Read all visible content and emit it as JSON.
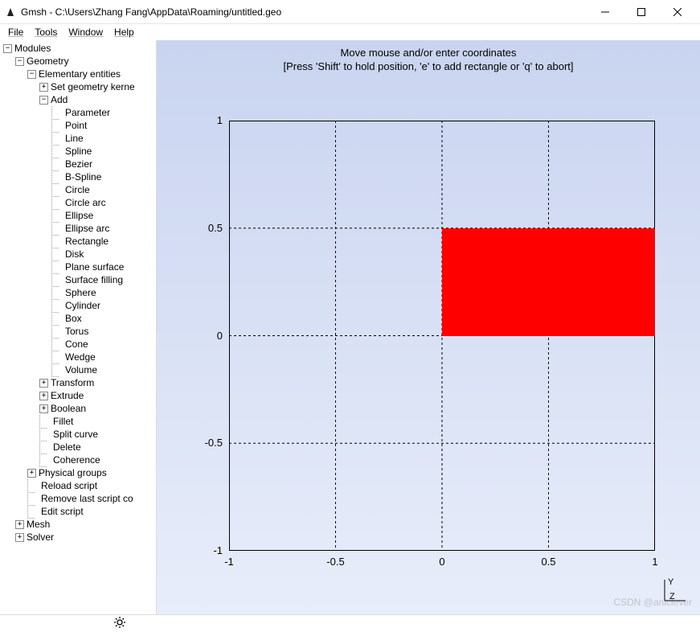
{
  "window": {
    "title": "Gmsh - C:\\Users\\Zhang Fang\\AppData\\Roaming/untitled.geo"
  },
  "menu": {
    "file": "File",
    "tools": "Tools",
    "window": "Window",
    "help": "Help"
  },
  "tree": {
    "root": "Modules",
    "geometry": "Geometry",
    "elementary": "Elementary entities",
    "set_kernel": "Set geometry kerne",
    "add": "Add",
    "add_items": [
      "Parameter",
      "Point",
      "Line",
      "Spline",
      "Bezier",
      "B-Spline",
      "Circle",
      "Circle arc",
      "Ellipse",
      "Ellipse arc",
      "Rectangle",
      "Disk",
      "Plane surface",
      "Surface filling",
      "Sphere",
      "Cylinder",
      "Box",
      "Torus",
      "Cone",
      "Wedge",
      "Volume"
    ],
    "transform": "Transform",
    "extrude": "Extrude",
    "boolean": "Boolean",
    "fillet": "Fillet",
    "split_curve": "Split curve",
    "delete": "Delete",
    "coherence": "Coherence",
    "physical": "Physical groups",
    "reload": "Reload script",
    "remove_last": "Remove last script co",
    "edit_script": "Edit script",
    "mesh": "Mesh",
    "solver": "Solver"
  },
  "hint": {
    "line1": "Move mouse and/or enter coordinates",
    "line2": "[Press 'Shift' to hold position, 'e' to add rectangle or 'q' to abort]"
  },
  "chart_data": {
    "type": "area",
    "title": "",
    "xlabel": "",
    "ylabel": "",
    "xlim": [
      -1,
      1
    ],
    "ylim": [
      -1,
      1
    ],
    "xticks": [
      -1,
      -0.5,
      0,
      0.5,
      1
    ],
    "yticks": [
      -1,
      -0.5,
      0,
      0.5,
      1
    ],
    "series": [
      {
        "name": "rectangle",
        "color": "#ff0000",
        "bounds": {
          "x0": 0,
          "y0": 0,
          "x1": 1,
          "y1": 0.5
        }
      }
    ],
    "grid": true,
    "axes3d": {
      "y": "Y",
      "z": "Z"
    }
  },
  "watermark": "CSDN @aniclever"
}
